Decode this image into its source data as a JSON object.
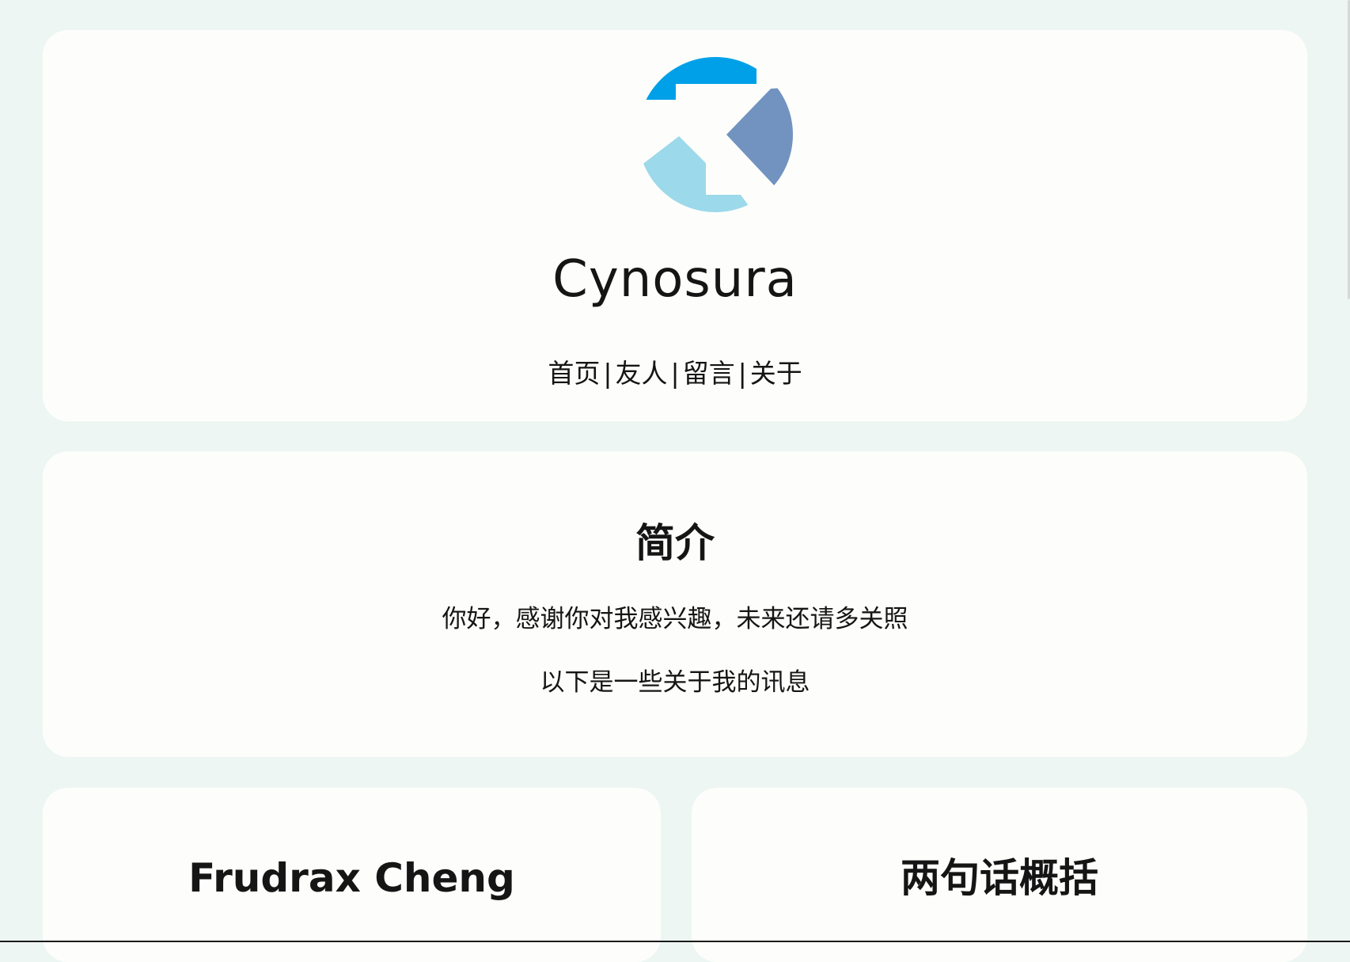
{
  "header": {
    "logo_icon": "logo-icon",
    "title": "Cynosura",
    "nav": [
      {
        "label": "首页"
      },
      {
        "label": "友人"
      },
      {
        "label": "留言"
      },
      {
        "label": "关于"
      }
    ],
    "separator": "|"
  },
  "intro": {
    "title": "简介",
    "lines": [
      "你好，感谢你对我感兴趣，未来还请多关照",
      "以下是一些关于我的讯息"
    ]
  },
  "profile": {
    "name": "Frudrax Cheng"
  },
  "summary": {
    "title": "两句话概括"
  },
  "colors": {
    "background": "#edf6f2",
    "card": "#fdfefb",
    "logo_blue": "#00a0e9",
    "logo_slate": "#7293c0",
    "logo_light": "#9cd9ea"
  }
}
